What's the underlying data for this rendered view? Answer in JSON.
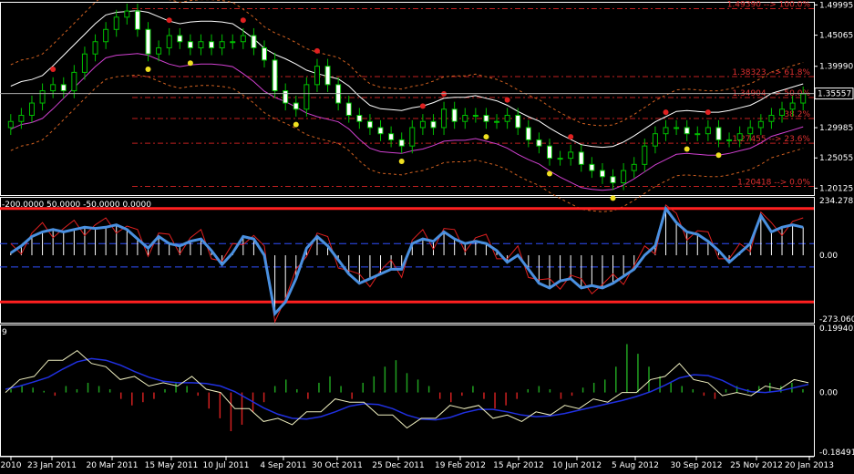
{
  "chart_data": [
    {
      "type": "line",
      "panel": "price",
      "description_series": [
        "candles",
        "bollinger",
        "envelopes",
        "fractals"
      ],
      "y_ticks": [
        "1.49995",
        "1.45065",
        "1.39990",
        "1.29985",
        "1.25055",
        "1.20125"
      ],
      "ylim": [
        1.19,
        1.505
      ],
      "current_price": "1.35557",
      "fibonacci": [
        {
          "label": "1.49390 --> 100.0%",
          "value": 1.4939
        },
        {
          "label": "1.38323 --> 61.8%",
          "value": 1.38323
        },
        {
          "label": "1.34904 --> 50.0%",
          "value": 1.34904
        },
        {
          "label": "38.2%",
          "value": 1.3148
        },
        {
          "label": "1.27455 --> 23.6%",
          "value": 1.2746
        },
        {
          "label": "1.20418 --> 0.0%",
          "value": 1.20418
        }
      ],
      "x_labels": [
        "2010",
        "23 Jan 2011",
        "20 Mar 2011",
        "15 May 2011",
        "10 Jul 2011",
        "4 Sep 2011",
        "30 Oct 2011",
        "25 Dec 2011",
        "19 Feb 2012",
        "15 Apr 2012",
        "10 Jun 2012",
        "5 Aug 2012",
        "30 Sep 2012",
        "25 Nov 2012",
        "20 Jan 2013"
      ],
      "close": [
        1.31,
        1.32,
        1.34,
        1.36,
        1.37,
        1.36,
        1.39,
        1.42,
        1.44,
        1.46,
        1.48,
        1.49,
        1.46,
        1.42,
        1.43,
        1.45,
        1.44,
        1.43,
        1.44,
        1.43,
        1.44,
        1.44,
        1.45,
        1.43,
        1.41,
        1.36,
        1.34,
        1.33,
        1.37,
        1.4,
        1.37,
        1.34,
        1.32,
        1.31,
        1.3,
        1.29,
        1.28,
        1.27,
        1.3,
        1.31,
        1.3,
        1.33,
        1.31,
        1.32,
        1.32,
        1.31,
        1.31,
        1.32,
        1.3,
        1.28,
        1.27,
        1.25,
        1.25,
        1.26,
        1.24,
        1.23,
        1.22,
        1.21,
        1.23,
        1.24,
        1.27,
        1.29,
        1.3,
        1.3,
        1.29,
        1.29,
        1.3,
        1.28,
        1.28,
        1.29,
        1.3,
        1.31,
        1.32,
        1.33,
        1.34,
        1.355
      ]
    },
    {
      "type": "line",
      "panel": "cci",
      "header": "-200.0000 50.0000 -50.0000 0.0000",
      "y_ticks": [
        "234.2782",
        "0.00",
        "-273.0609"
      ],
      "ylim": [
        -273.0609,
        234.2782
      ],
      "levels": [
        200,
        50,
        -50,
        -200
      ],
      "cci": [
        10,
        40,
        80,
        100,
        110,
        100,
        110,
        120,
        115,
        120,
        130,
        110,
        70,
        30,
        80,
        50,
        40,
        60,
        70,
        20,
        -40,
        10,
        80,
        70,
        0,
        -250,
        -200,
        -100,
        30,
        80,
        40,
        -20,
        -80,
        -120,
        -100,
        -80,
        -60,
        -60,
        50,
        70,
        60,
        100,
        70,
        50,
        60,
        50,
        20,
        -30,
        0,
        -60,
        -120,
        -140,
        -110,
        -100,
        -140,
        -130,
        -140,
        -120,
        -90,
        -60,
        0,
        40,
        200,
        140,
        100,
        90,
        60,
        20,
        -30,
        10,
        50,
        170,
        100,
        120,
        130,
        120
      ]
    },
    {
      "type": "bar",
      "panel": "macd",
      "header": "9",
      "y_ticks": [
        "0.199402",
        "0.00",
        "-0.184919"
      ],
      "ylim": [
        -0.184919,
        0.199402
      ],
      "histogram": [
        0.01,
        0.02,
        0.015,
        0.005,
        -0.01,
        0.02,
        0.01,
        0.03,
        0.02,
        0.01,
        -0.02,
        -0.04,
        -0.03,
        -0.02,
        0.01,
        0.03,
        0.02,
        -0.01,
        -0.05,
        -0.08,
        -0.12,
        -0.1,
        -0.06,
        -0.03,
        0.02,
        0.04,
        0.01,
        -0.02,
        0.03,
        0.05,
        0.02,
        -0.02,
        0.03,
        0.05,
        0.08,
        0.1,
        0.06,
        0.04,
        0.02,
        -0.02,
        -0.03,
        -0.01,
        0.02,
        -0.02,
        -0.05,
        -0.04,
        -0.02,
        0.01,
        0.02,
        0.01,
        -0.02,
        -0.01,
        0.015,
        0.03,
        0.04,
        0.08,
        0.15,
        0.12,
        0.08,
        0.05,
        0.03,
        0.02,
        0.01,
        -0.01,
        -0.02,
        0.01,
        0.02,
        0.01,
        0.02,
        0.03,
        0.02,
        0.03,
        0.01
      ],
      "macd": [
        0.01,
        0.03,
        0.06,
        0.09,
        0.11,
        0.12,
        0.1,
        0.07,
        0.05,
        0.04,
        0.03,
        0.02,
        0.03,
        0.04,
        0.02,
        -0.01,
        -0.04,
        -0.06,
        -0.08,
        -0.09,
        -0.09,
        -0.07,
        -0.05,
        -0.03,
        -0.02,
        -0.04,
        -0.06,
        -0.08,
        -0.1,
        -0.09,
        -0.07,
        -0.05,
        -0.04,
        -0.05,
        -0.07,
        -0.08,
        -0.08,
        -0.07,
        -0.06,
        -0.05,
        -0.04,
        -0.03,
        -0.02,
        -0.01,
        0.01,
        0.03,
        0.06,
        0.08,
        0.05,
        0.02,
        0.0,
        -0.01,
        0.0,
        0.01,
        0.02,
        0.03,
        0.04
      ]
    }
  ]
}
